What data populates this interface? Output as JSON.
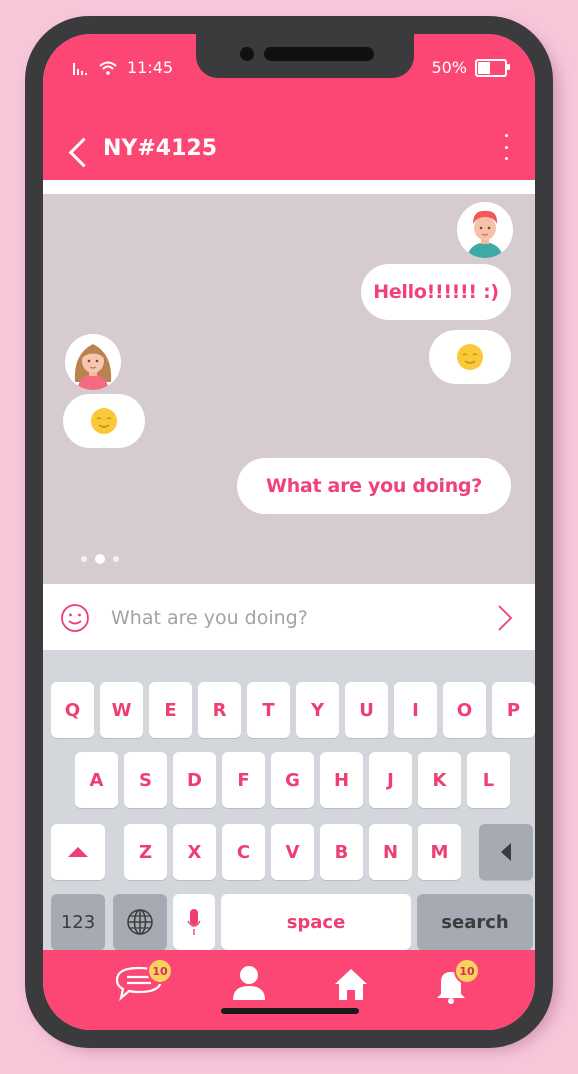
{
  "status": {
    "time": "11:45",
    "battery": "50%",
    "battery_level": 0.5
  },
  "header": {
    "title": "NY#4125"
  },
  "messages": {
    "m1": "Hello!!!!!! :)",
    "m4": "What are you doing?"
  },
  "input": {
    "placeholder": "What are you doing?"
  },
  "keyboard": {
    "row1": [
      "Q",
      "W",
      "E",
      "R",
      "T",
      "Y",
      "U",
      "I",
      "O",
      "P"
    ],
    "row2": [
      "A",
      "S",
      "D",
      "F",
      "G",
      "H",
      "J",
      "K",
      "L"
    ],
    "row3": [
      "Z",
      "X",
      "C",
      "V",
      "B",
      "N",
      "M"
    ],
    "num_label": "123",
    "space_label": "space",
    "search_label": "search"
  },
  "nav": {
    "messages_badge": "10",
    "notifications_badge": "10"
  },
  "colors": {
    "accent": "#fc4775",
    "badge": "#f7d25e",
    "background": "#f7c6d9"
  }
}
